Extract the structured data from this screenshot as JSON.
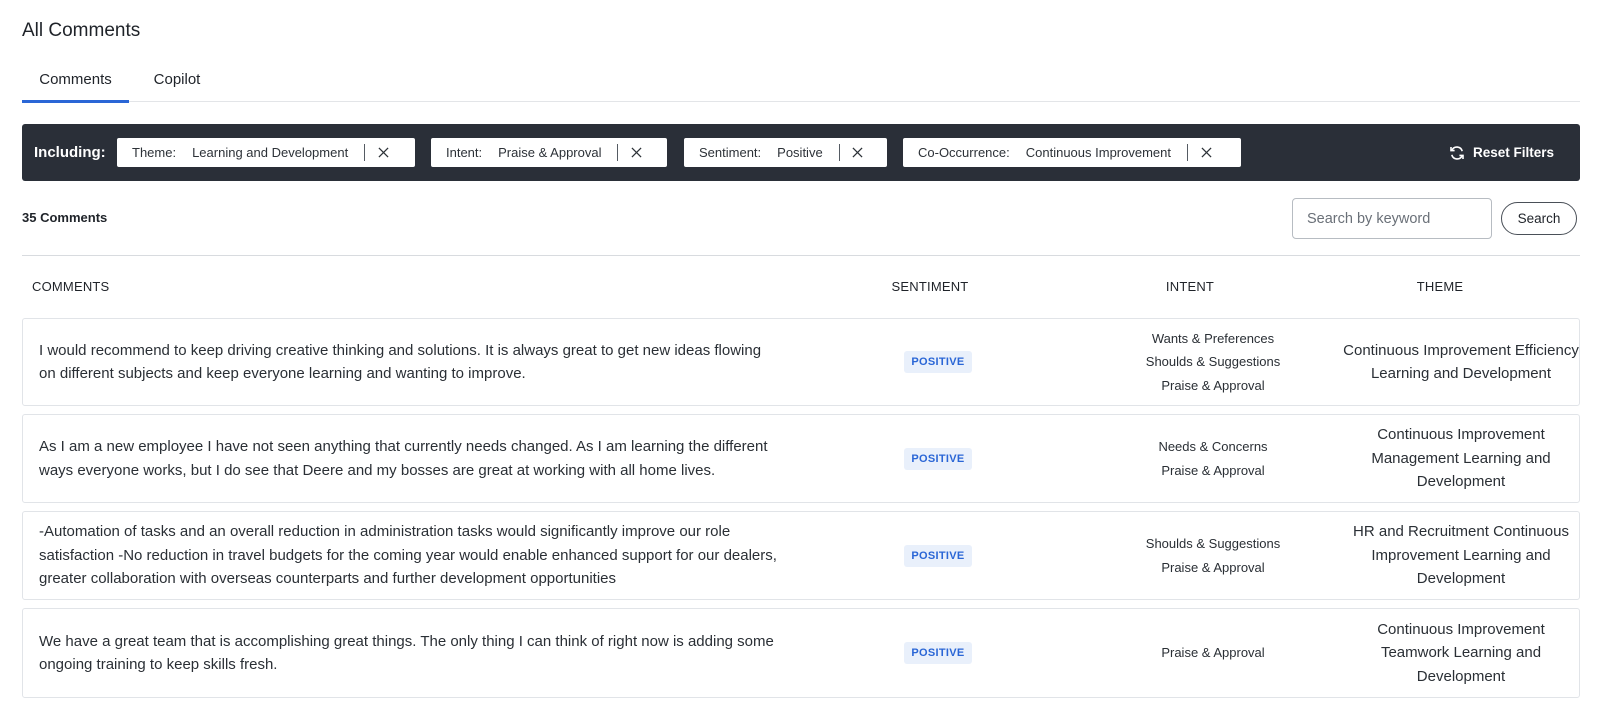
{
  "page": {
    "title": "All Comments"
  },
  "tabs": [
    {
      "label": "Comments",
      "active": true
    },
    {
      "label": "Copilot",
      "active": false
    }
  ],
  "filters": {
    "including_label": "Including:",
    "chips": [
      {
        "key": "Theme:",
        "value": "Learning and Development"
      },
      {
        "key": "Intent:",
        "value": "Praise & Approval"
      },
      {
        "key": "Sentiment:",
        "value": "Positive"
      },
      {
        "key": "Co-Occurrence:",
        "value": "Continuous Improvement"
      }
    ],
    "reset_label": "Reset Filters"
  },
  "summary": {
    "count_text": "35 Comments"
  },
  "search": {
    "placeholder": "Search by keyword",
    "value": "",
    "button_label": "Search"
  },
  "table": {
    "headers": {
      "comments": "COMMENTS",
      "sentiment": "SENTIMENT",
      "intent": "INTENT",
      "theme": "THEME"
    },
    "rows": [
      {
        "comment": "I would recommend to keep driving creative thinking and solutions. It is always great to get new ideas flowing on different subjects and keep everyone learning and wanting to improve.",
        "sentiment": "POSITIVE",
        "intents": [
          "Wants & Preferences",
          "Shoulds & Suggestions",
          "Praise & Approval"
        ],
        "theme": "Continuous Improvement Efficiency Learning and Development"
      },
      {
        "comment": "As I am a new employee I have not seen anything that currently needs changed. As I am learning the different ways everyone works, but I do see that Deere and my bosses are great at working with all home lives.",
        "sentiment": "POSITIVE",
        "intents": [
          "Needs & Concerns",
          "Praise & Approval"
        ],
        "theme": "Continuous Improvement Management Learning and Development"
      },
      {
        "comment": "-Automation of tasks and an overall reduction in administration tasks would significantly improve our role satisfaction -No reduction in travel budgets for the coming year would enable enhanced support for our dealers, greater collaboration with overseas counterparts and further development opportunities",
        "sentiment": "POSITIVE",
        "intents": [
          "Shoulds & Suggestions",
          "Praise & Approval"
        ],
        "theme": "HR and Recruitment Continuous Improvement Learning and Development"
      },
      {
        "comment": "We have a great team that is accomplishing great things. The only thing I can think of right now is adding some ongoing training to keep skills fresh.",
        "sentiment": "POSITIVE",
        "intents": [
          "Praise & Approval"
        ],
        "theme": "Continuous Improvement Teamwork Learning and Development"
      }
    ]
  },
  "colors": {
    "accent": "#2a66d6",
    "filter_bar": "#2a2f38",
    "badge_bg": "#e9f0fb"
  },
  "icons": {
    "chip_remove": "close-icon",
    "reset": "refresh-icon"
  }
}
